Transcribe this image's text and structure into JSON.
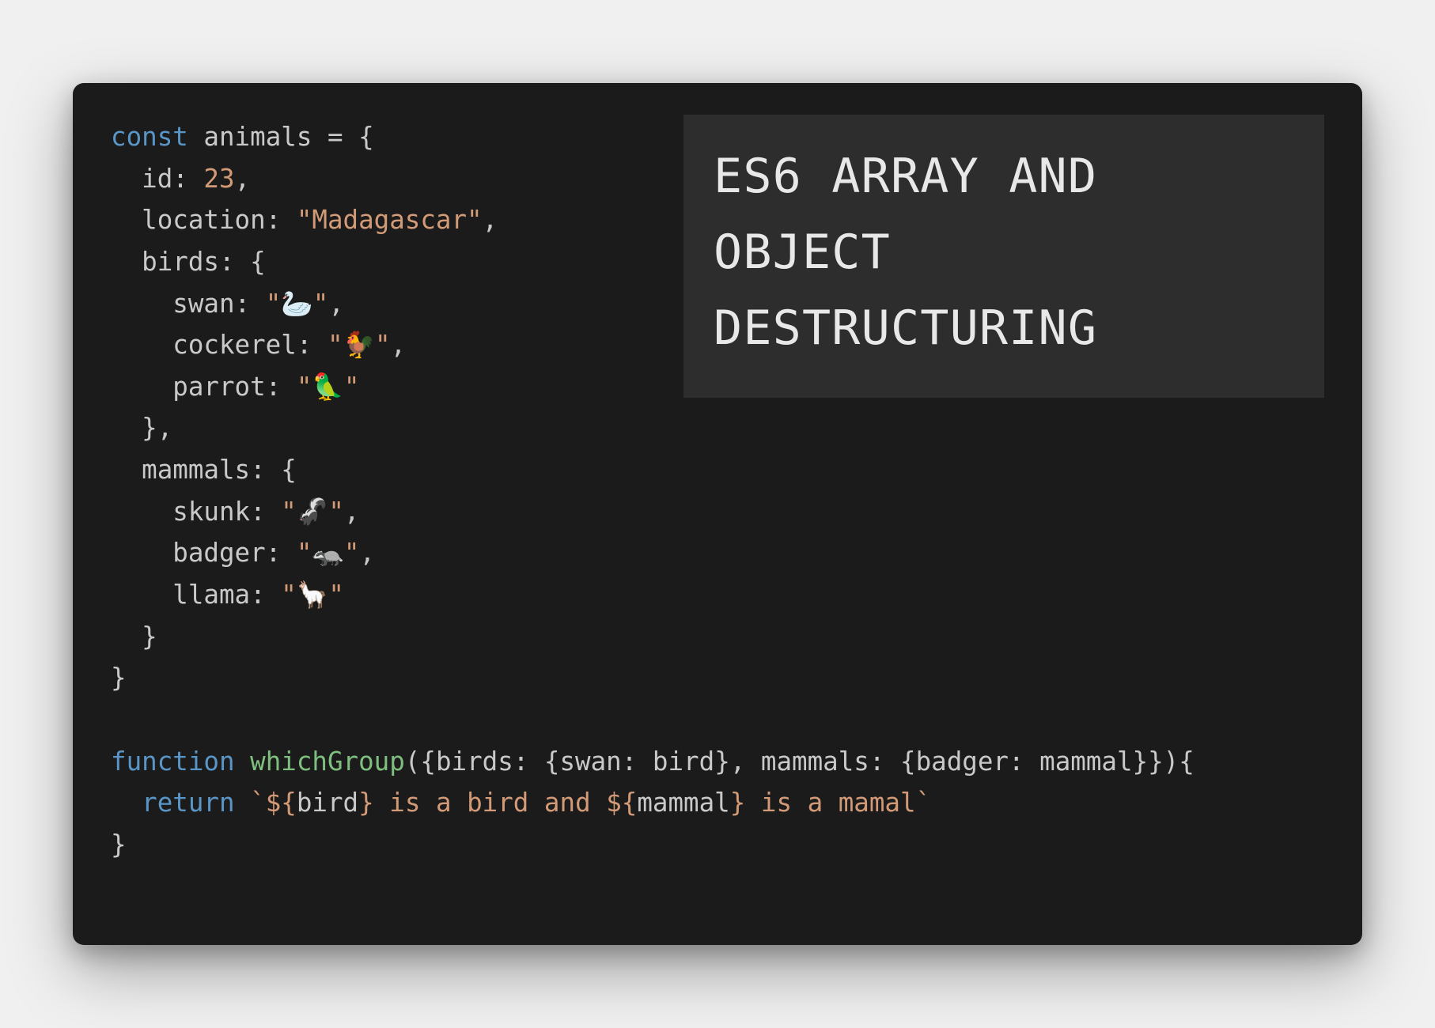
{
  "title": {
    "line1": "ES6 ARRAY AND",
    "line2": "OBJECT",
    "line3": "DESTRUCTURING"
  },
  "code": {
    "kw_const": "const",
    "var_animals": "animals",
    "eq_open": " = {",
    "prop_id": "id",
    "val_id": "23",
    "prop_location": "location",
    "val_location": "\"Madagascar\"",
    "prop_birds": "birds",
    "open_brace": ": {",
    "prop_swan": "swan",
    "val_swan_open": "\"",
    "val_swan_emoji": "🦢",
    "val_swan_close": "\"",
    "prop_cockerel": "cockerel",
    "val_cockerel_open": "\"",
    "val_cockerel_emoji": "🐓",
    "val_cockerel_close": "\"",
    "prop_parrot": "parrot",
    "val_parrot_open": "\"",
    "val_parrot_emoji": "🦜",
    "val_parrot_close": "\"",
    "close_brace_comma": "},",
    "prop_mammals": "mammals",
    "prop_skunk": "skunk",
    "val_skunk_open": "\"",
    "val_skunk_emoji": "🦨",
    "val_skunk_close": "\"",
    "prop_badger": "badger",
    "val_badger_open": "\"",
    "val_badger_emoji": "🦡",
    "val_badger_close": "\"",
    "prop_llama": "llama",
    "val_llama_open": "\"",
    "val_llama_emoji": "🦙",
    "val_llama_close": "\"",
    "close_brace": "}",
    "kw_function": "function",
    "fn_name": "whichGroup",
    "fn_params": "({",
    "p_birds": "birds",
    "p_colon_open": ": {",
    "p_swan": "swan",
    "p_colon": ": ",
    "p_bird": "bird",
    "p_close": "}",
    "p_comma": ", ",
    "p_mammals": "mammals",
    "p_badger": "badger",
    "p_mammal": "mammal",
    "fn_params_end": "}}){",
    "kw_return": "return",
    "tmpl_tick": "`",
    "tmpl_open": "${",
    "tmpl_bird": "bird",
    "tmpl_close": "}",
    "tmpl_mid1": " is a bird and ",
    "tmpl_mammal": "mammal",
    "tmpl_mid2": " is a mamal",
    "fn_close": "}"
  }
}
